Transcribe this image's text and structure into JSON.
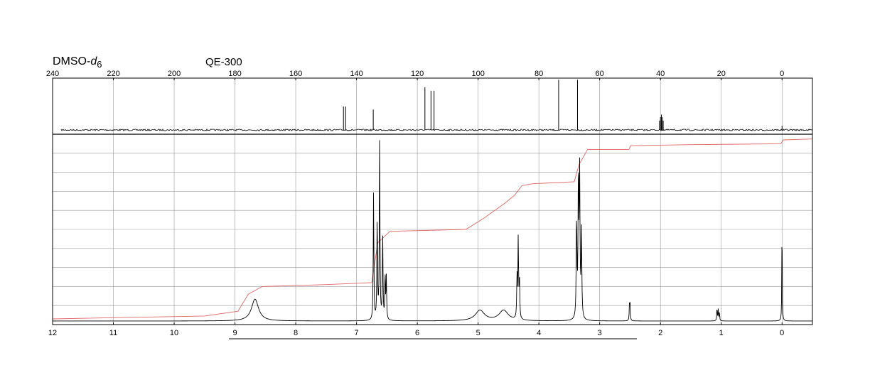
{
  "header": {
    "solvent_main": "DMSO-",
    "solvent_italic": "d",
    "solvent_sub": "6",
    "instrument": "QE-300"
  },
  "chart_data": [
    {
      "type": "line",
      "panel": "13C",
      "x_ticks": [
        "240",
        "220",
        "200",
        "180",
        "160",
        "140",
        "120",
        "100",
        "80",
        "60",
        "40",
        "20",
        "0"
      ],
      "xlim": [
        240,
        -10
      ],
      "x_reversed": true,
      "peaks": [
        {
          "x": 144.3,
          "y": 0.55
        },
        {
          "x": 143.6,
          "y": 0.55
        },
        {
          "x": 134.5,
          "y": 0.48
        },
        {
          "x": 117.5,
          "y": 1.0
        },
        {
          "x": 115.5,
          "y": 0.92
        },
        {
          "x": 114.5,
          "y": 0.92
        },
        {
          "x": 73.5,
          "y": 1.18
        },
        {
          "x": 67.3,
          "y": 1.18
        },
        {
          "x": 40.3,
          "y": 0.22
        },
        {
          "x": 40.0,
          "y": 0.3
        },
        {
          "x": 39.7,
          "y": 0.36
        },
        {
          "x": 39.4,
          "y": 0.3
        },
        {
          "x": 39.1,
          "y": 0.22
        },
        {
          "x": 0.0,
          "y": 0.1
        }
      ],
      "grid": true
    },
    {
      "type": "line",
      "panel": "1H",
      "x_ticks": [
        "12",
        "11",
        "10",
        "9",
        "8",
        "7",
        "6",
        "5",
        "4",
        "3",
        "2",
        "1",
        "0"
      ],
      "xlim": [
        12,
        -0.5
      ],
      "x_reversed": true,
      "peaks": [
        {
          "x": 8.67,
          "y": 0.115,
          "w": 0.07
        },
        {
          "x": 6.72,
          "y": 0.67,
          "w": 0.006
        },
        {
          "x": 6.66,
          "y": 0.55,
          "w": 0.006
        },
        {
          "x": 6.62,
          "y": 0.96,
          "w": 0.006
        },
        {
          "x": 6.57,
          "y": 0.45,
          "w": 0.006
        },
        {
          "x": 6.53,
          "y": 0.24,
          "w": 0.006
        },
        {
          "x": 6.51,
          "y": 0.22,
          "w": 0.006
        },
        {
          "x": 4.97,
          "y": 0.055,
          "w": 0.09
        },
        {
          "x": 4.58,
          "y": 0.055,
          "w": 0.09
        },
        {
          "x": 4.36,
          "y": 0.22,
          "w": 0.006
        },
        {
          "x": 4.34,
          "y": 0.42,
          "w": 0.006
        },
        {
          "x": 4.32,
          "y": 0.22,
          "w": 0.006
        },
        {
          "x": 3.38,
          "y": 0.52,
          "w": 0.007
        },
        {
          "x": 3.35,
          "y": 0.75,
          "w": 0.007
        },
        {
          "x": 3.33,
          "y": 0.75,
          "w": 0.007
        },
        {
          "x": 3.3,
          "y": 0.45,
          "w": 0.007
        },
        {
          "x": 2.51,
          "y": 0.085,
          "w": 0.005
        },
        {
          "x": 2.5,
          "y": 0.085,
          "w": 0.005
        },
        {
          "x": 1.07,
          "y": 0.07,
          "w": 0.005
        },
        {
          "x": 1.05,
          "y": 0.06,
          "w": 0.005
        },
        {
          "x": 1.03,
          "y": 0.045,
          "w": 0.005
        },
        {
          "x": 0.0,
          "y": 0.58,
          "w": 0.004
        }
      ],
      "integral": [
        {
          "x": 12.0,
          "y": 0.03
        },
        {
          "x": 9.5,
          "y": 0.045
        },
        {
          "x": 8.95,
          "y": 0.07
        },
        {
          "x": 8.78,
          "y": 0.16
        },
        {
          "x": 8.55,
          "y": 0.2
        },
        {
          "x": 7.5,
          "y": 0.21
        },
        {
          "x": 6.75,
          "y": 0.22
        },
        {
          "x": 6.65,
          "y": 0.43
        },
        {
          "x": 6.45,
          "y": 0.49
        },
        {
          "x": 5.2,
          "y": 0.5
        },
        {
          "x": 4.9,
          "y": 0.56
        },
        {
          "x": 4.55,
          "y": 0.64
        },
        {
          "x": 4.4,
          "y": 0.68
        },
        {
          "x": 4.28,
          "y": 0.73
        },
        {
          "x": 4.1,
          "y": 0.74
        },
        {
          "x": 3.42,
          "y": 0.75
        },
        {
          "x": 3.34,
          "y": 0.84
        },
        {
          "x": 3.2,
          "y": 0.92
        },
        {
          "x": 2.52,
          "y": 0.92
        },
        {
          "x": 2.49,
          "y": 0.94
        },
        {
          "x": 1.5,
          "y": 0.945
        },
        {
          "x": 0.02,
          "y": 0.95
        },
        {
          "x": -0.02,
          "y": 0.97
        },
        {
          "x": -0.5,
          "y": 0.975
        }
      ],
      "grid": true
    }
  ],
  "colors": {
    "trace": "#000000",
    "integral": "#e06666",
    "grid": "#9a9a9a",
    "frame": "#000000"
  }
}
